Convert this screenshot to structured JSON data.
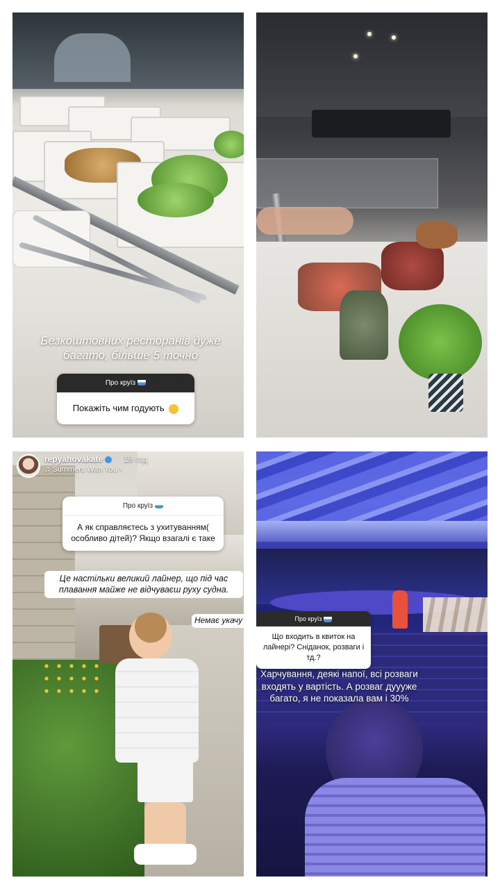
{
  "panels": {
    "top_left": {
      "overlay_text": "Безкоштовних ресторанів дуже багато, більше 5 точно",
      "question": {
        "header": "Про круїз",
        "header_icon": "ship-icon",
        "body": "Покажіть чим годують",
        "body_icon": "smiling-face-emoji"
      }
    },
    "top_right": {},
    "bottom_left": {
      "username": "repyahovakate",
      "time": "19 год",
      "music": "Summers With You",
      "question": {
        "header": "Про круїз",
        "body": "А як справляєтесь з ухитуванням( особливо дітей)? Якщо взагалі є таке"
      },
      "answer": "Це настільки великий лайнер, що під час плавання майже не відчуваєш руху судна.",
      "side_note": "Немає укачу"
    },
    "bottom_right": {
      "question": {
        "header": "Про круїз",
        "body": "Що входить в квиток на лайнері? Сніданок, розваги і тд.?"
      },
      "answer": "Харчування, деякі напої, всі розваги входять у вартість. А розваг дуууже багато, я не показала вам і 30%"
    }
  }
}
